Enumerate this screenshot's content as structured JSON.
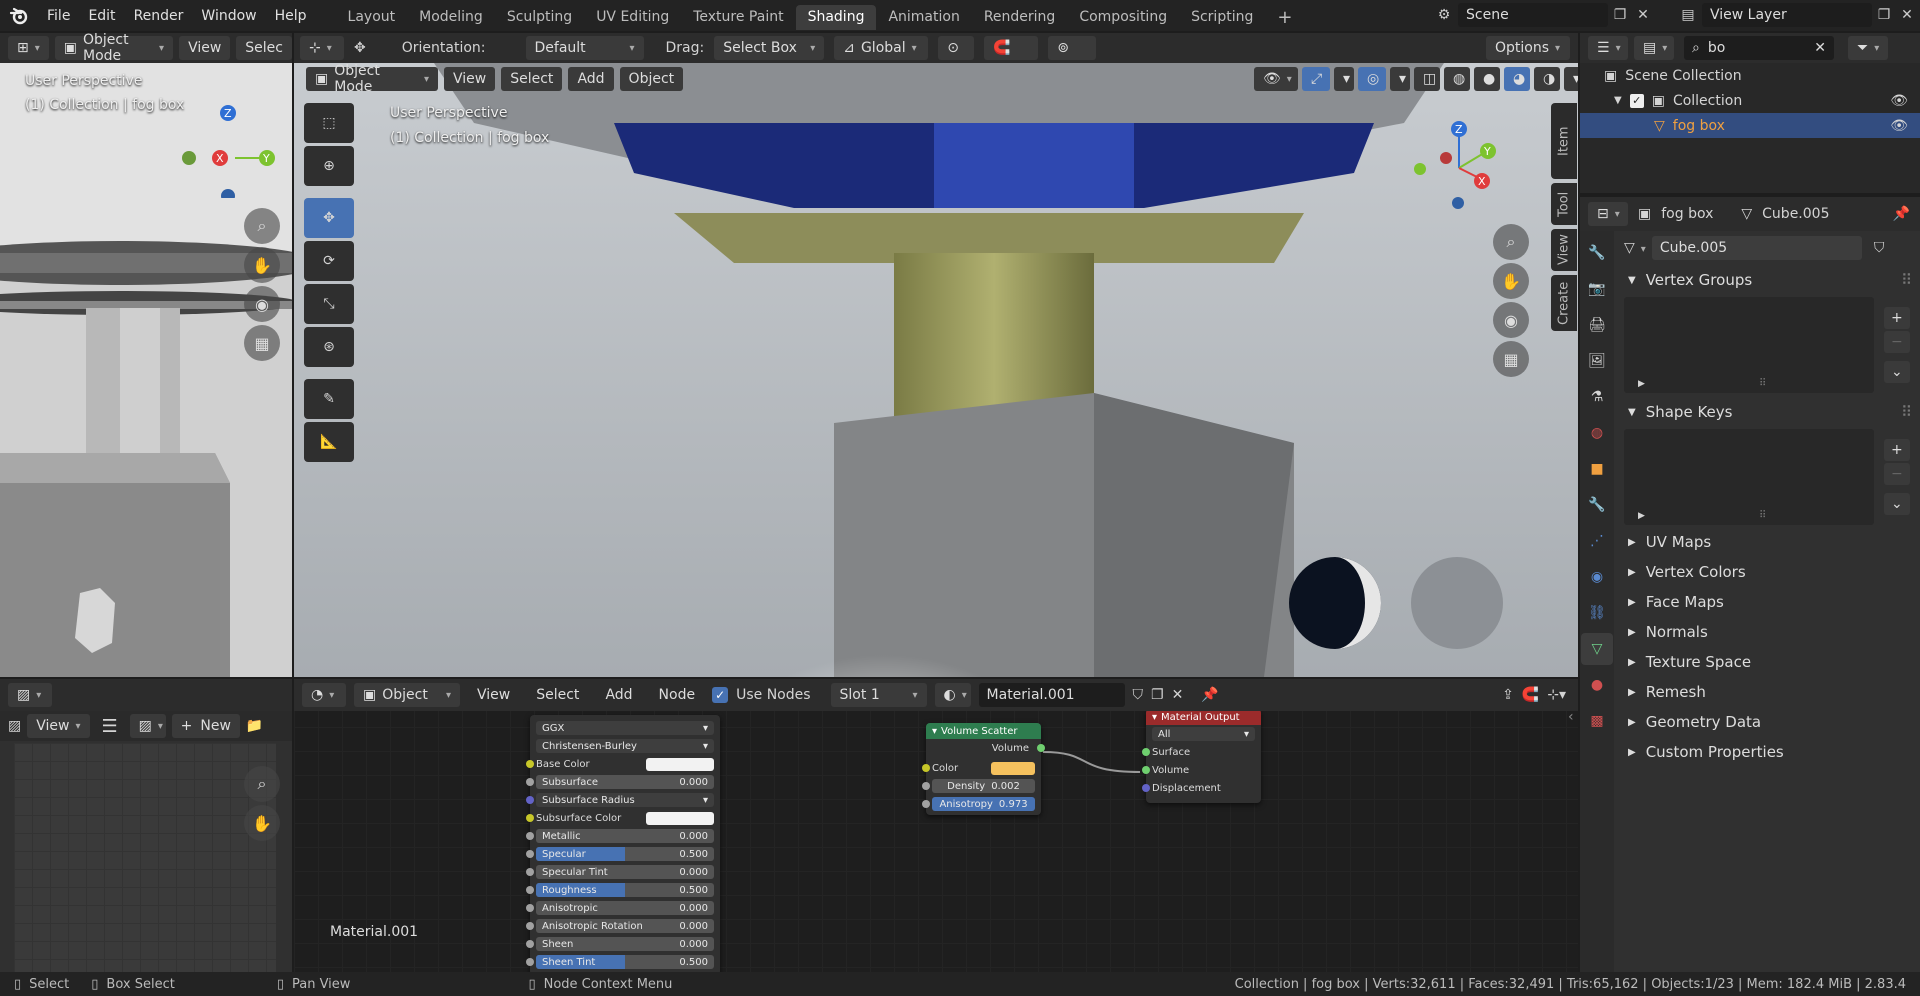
{
  "topbar": {
    "menus": [
      "File",
      "Edit",
      "Render",
      "Window",
      "Help"
    ],
    "workspaces": [
      "Layout",
      "Modeling",
      "Sculpting",
      "UV Editing",
      "Texture Paint",
      "Shading",
      "Animation",
      "Rendering",
      "Compositing",
      "Scripting"
    ],
    "active_workspace": "Shading",
    "scene": "Scene",
    "view_layer": "View Layer"
  },
  "left_viewport": {
    "mode": "Object Mode",
    "view": "View",
    "select": "Selec",
    "perspective": "User Perspective",
    "collection": "(1) Collection | fog box"
  },
  "main_viewport": {
    "orientation_label": "Orientation:",
    "orientation_value": "Default",
    "drag_label": "Drag:",
    "drag_value": "Select Box",
    "transform": "Global",
    "options": "Options",
    "mode": "Object Mode",
    "menu": [
      "View",
      "Select",
      "Add",
      "Object"
    ],
    "perspective": "User Perspective",
    "collection": "(1) Collection | fog box",
    "side_tabs": [
      "Item",
      "Tool",
      "View",
      "Create"
    ]
  },
  "outliner": {
    "search": "bo",
    "scene_collection": "Scene Collection",
    "collection": "Collection",
    "object": "fog box"
  },
  "properties": {
    "object": "fog box",
    "mesh": "Cube.005",
    "datablock": "Cube.005",
    "panels_open": [
      "Vertex Groups",
      "Shape Keys"
    ],
    "panels_closed": [
      "UV Maps",
      "Vertex Colors",
      "Face Maps",
      "Normals",
      "Texture Space",
      "Remesh",
      "Geometry Data",
      "Custom Properties"
    ]
  },
  "image_editor": {
    "view": "View",
    "new": "New"
  },
  "node_editor": {
    "object": "Object",
    "menu": [
      "View",
      "Select",
      "Add",
      "Node"
    ],
    "use_nodes": "Use Nodes",
    "slot": "Slot 1",
    "material": "Material.001",
    "material_label": "Material.001",
    "bsdf": {
      "distribution": "GGX",
      "subsurface_method": "Christensen-Burley",
      "rows": [
        {
          "label": "Base Color",
          "type": "color",
          "color": "#f2f2f2"
        },
        {
          "label": "Subsurface",
          "value": "0.000",
          "fill": 0
        },
        {
          "label": "Subsurface Radius",
          "type": "dropdown"
        },
        {
          "label": "Subsurface Color",
          "type": "color",
          "color": "#f2f2f2"
        },
        {
          "label": "Metallic",
          "value": "0.000",
          "fill": 0
        },
        {
          "label": "Specular",
          "value": "0.500",
          "fill": 0.5
        },
        {
          "label": "Specular Tint",
          "value": "0.000",
          "fill": 0
        },
        {
          "label": "Roughness",
          "value": "0.500",
          "fill": 0.5
        },
        {
          "label": "Anisotropic",
          "value": "0.000",
          "fill": 0
        },
        {
          "label": "Anisotropic Rotation",
          "value": "0.000",
          "fill": 0
        },
        {
          "label": "Sheen",
          "value": "0.000",
          "fill": 0
        },
        {
          "label": "Sheen Tint",
          "value": "0.500",
          "fill": 0.5
        }
      ]
    },
    "volume_scatter": {
      "title": "Volume Scatter",
      "output": "Volume",
      "color_label": "Color",
      "color": "#f5c15e",
      "density_label": "Density",
      "density": "0.002",
      "anisotropy_label": "Anisotropy",
      "anisotropy": "0.973"
    },
    "material_output": {
      "title": "Material Output",
      "target": "All",
      "inputs": [
        "Surface",
        "Volume",
        "Displacement"
      ]
    }
  },
  "status": {
    "left": [
      "Select",
      "Box Select",
      "Pan View",
      "Node Context Menu"
    ],
    "right": "Collection | fog box | Verts:32,611 | Faces:32,491 | Tris:65,162 | Objects:1/23 | Mem: 182.4 MiB | 2.83.4"
  },
  "colors": {
    "accent": "#4772b3",
    "selected_row": "#334d80",
    "object_orange": "#f0a040",
    "node_header_green": "#2e7d4f",
    "node_header_red": "#9b2b2b"
  }
}
